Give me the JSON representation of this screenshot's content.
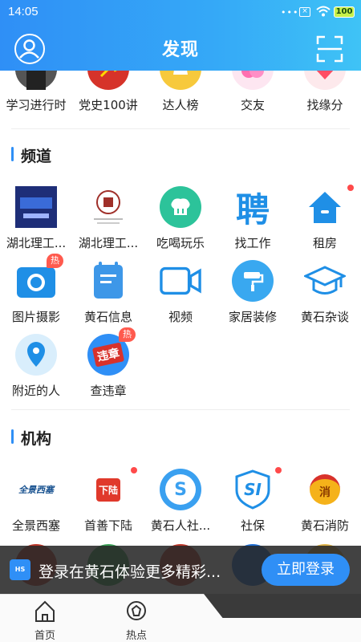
{
  "status_bar": {
    "time": "14:05",
    "dots": "•••",
    "battery": "100"
  },
  "header": {
    "title": "发现"
  },
  "top_row": [
    {
      "label": "学习进行时"
    },
    {
      "label": "党史100讲"
    },
    {
      "label": "达人榜"
    },
    {
      "label": "交友"
    },
    {
      "label": "找缘分"
    }
  ],
  "channels": {
    "title": "频道",
    "items": [
      {
        "label": "湖北理工...",
        "icon": "poster-thumbnail"
      },
      {
        "label": "湖北理工...",
        "icon": "university-seal"
      },
      {
        "label": "吃喝玩乐",
        "icon": "chef-hat-icon"
      },
      {
        "label": "找工作",
        "icon": "hire-character-icon",
        "glyph": "聘"
      },
      {
        "label": "租房",
        "icon": "house-icon",
        "dot": true
      },
      {
        "label": "图片摄影",
        "icon": "camera-icon",
        "badge": "热"
      },
      {
        "label": "黄石信息",
        "icon": "document-icon"
      },
      {
        "label": "视频",
        "icon": "video-camera-icon"
      },
      {
        "label": "家居装修",
        "icon": "paint-roller-icon"
      },
      {
        "label": "黄石杂谈",
        "icon": "graduation-cap-icon"
      },
      {
        "label": "附近的人",
        "icon": "location-pin-icon"
      },
      {
        "label": "查违章",
        "icon": "traffic-violation-icon",
        "badge": "热",
        "glyph": "违章"
      }
    ]
  },
  "institutions": {
    "title": "机构",
    "items": [
      {
        "label": "全景西塞",
        "icon": "xisai-logo",
        "glyph": "全景西塞"
      },
      {
        "label": "首善下陆",
        "icon": "xialu-logo",
        "dot": true,
        "glyph": "下陆"
      },
      {
        "label": "黄石人社...",
        "icon": "social-security-logo",
        "glyph": "S"
      },
      {
        "label": "社保",
        "icon": "si-shield-icon",
        "dot": true,
        "glyph": "SI"
      },
      {
        "label": "黄石消防",
        "icon": "fire-mascot-icon",
        "glyph": "消"
      }
    ]
  },
  "login_banner": {
    "logo_text": "HS",
    "text": "登录在黄石体验更多精彩...",
    "button": "立即登录"
  },
  "tabbar": {
    "tabs": [
      {
        "label": "首页"
      },
      {
        "label": "热点"
      }
    ]
  },
  "colors": {
    "primary": "#2f8ff6",
    "badge": "#ff5a4e"
  }
}
